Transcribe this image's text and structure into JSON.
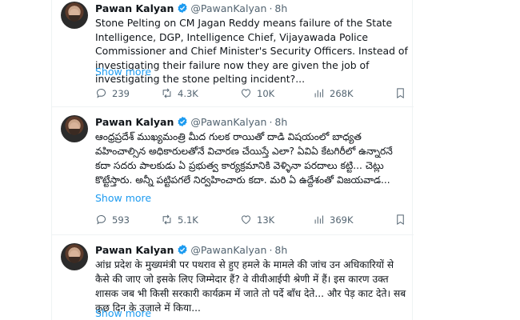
{
  "tweets": [
    {
      "name": "Pawan Kalyan",
      "handle": "@PawanKalyan",
      "dot": "·",
      "time": "8h",
      "text": "Stone Pelting on CM Jagan Reddy means failure of the State Intelligence, DGP, Intelligence Chief, Vijayawada Police Commissioner and Chief Minister's Security Officers. Instead of investigating their failure now they are given the job of investigating the stone pelting incident?...",
      "show_more": "Show more",
      "replies": "239",
      "reposts": "4.3K",
      "likes": "10K",
      "views": "268K"
    },
    {
      "name": "Pawan Kalyan",
      "handle": "@PawanKalyan",
      "dot": "·",
      "time": "8h",
      "text": "ఆంధ్రప్రదేశ్ ముఖ్యమంత్రి మీద గులక రాయితో దాడి విషయంలో బాధ్యత వహించాల్సిన అధికారులతోనే విచారణ చేయిస్తే ఎలా? ఏవిఏ కేటగిరీలో ఉన్నారనే కదా సదరు పాలకుడు ఏ ప్రభుత్వ కార్యక్రమానికి వెళ్ళినా పరదాలు కట్టి... చెట్లు కొట్టేస్తారు. అన్నీ పట్టిపగలే నిర్వహించారు కదా. మరి ఏ ఉద్దేశంతో విజయవాడ...",
      "show_more": "Show more",
      "replies": "593",
      "reposts": "5.1K",
      "likes": "13K",
      "views": "369K"
    },
    {
      "name": "Pawan Kalyan",
      "handle": "@PawanKalyan",
      "dot": "·",
      "time": "8h",
      "text": "आंध्र प्रदेश के मुख्यमंत्री पर पथराव से हुए हमले के मामले की जांच उन अधिकारियों से कैसे की जाए जो इसके लिए जिम्मेदार हैं? वे वीवीआईपी श्रेणी में हैं। इस कारण उक्त शासक जब भी किसी सरकारी कार्यक्रम में जाते तो पर्दे बाँध देते... और पेड़ काट देते। सब कुछ दिन के उजाले में किया...",
      "show_more": "Show more"
    }
  ],
  "colors": {
    "text": "#0f1419",
    "secondary": "#536471",
    "link": "#1d9bf0",
    "verified": "#1d9bf0",
    "divider": "#eff3f4"
  },
  "icons": [
    "reply-icon",
    "repost-icon",
    "like-icon",
    "views-icon",
    "bookmark-icon",
    "verified-badge-icon"
  ]
}
